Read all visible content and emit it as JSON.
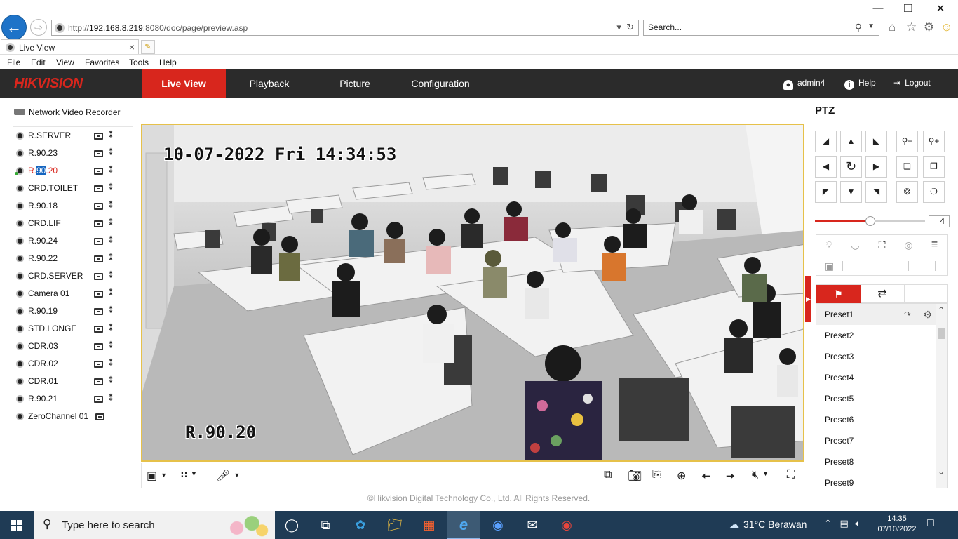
{
  "browser": {
    "url_prefix": "http://",
    "url_host": "192.168.8.219",
    "url_rest": ":8080/doc/page/preview.asp",
    "search_placeholder": "Search...",
    "tab_title": "Live View",
    "menu": [
      "File",
      "Edit",
      "View",
      "Favorites",
      "Tools",
      "Help"
    ]
  },
  "header": {
    "logo_main": "HIK",
    "logo_rest": "VISION",
    "nav": [
      "Live View",
      "Playback",
      "Picture",
      "Configuration"
    ],
    "active_nav": "Live View",
    "user": "admin4",
    "help": "Help",
    "logout": "Logout"
  },
  "sidebar": {
    "root": "Network Video Recorder",
    "cameras": [
      {
        "name": "R.SERVER"
      },
      {
        "name": "R.90.23"
      },
      {
        "name_pre": "R.",
        "name_hl": "90",
        "name_post": ".20",
        "active": true
      },
      {
        "name": "CRD.TOILET"
      },
      {
        "name": "R.90.18"
      },
      {
        "name": "CRD.LIF"
      },
      {
        "name": "R.90.24"
      },
      {
        "name": "R.90.22"
      },
      {
        "name": "CRD.SERVER"
      },
      {
        "name": "Camera 01"
      },
      {
        "name": "R.90.19"
      },
      {
        "name": "STD.LONGE"
      },
      {
        "name": "CDR.03"
      },
      {
        "name": "CDR.02"
      },
      {
        "name": "CDR.01"
      },
      {
        "name": "R.90.21"
      },
      {
        "name": "ZeroChannel 01",
        "zero": true
      }
    ]
  },
  "video": {
    "osd_time": "10-07-2022 Fri 14:34:53",
    "osd_name": "R.90.20",
    "border_color": "#e6c14a"
  },
  "footer": {
    "copyright": "©Hikvision Digital Technology Co., Ltd. All Rights Reserved."
  },
  "ptz": {
    "title": "PTZ",
    "speed": 4,
    "speed_max": 7,
    "presets": [
      "Preset1",
      "Preset2",
      "Preset3",
      "Preset4",
      "Preset5",
      "Preset6",
      "Preset7",
      "Preset8",
      "Preset9"
    ],
    "selected_preset": "Preset1"
  },
  "taskbar": {
    "search_placeholder": "Type here to search",
    "weather": "31°C Berawan",
    "time": "14:35",
    "date": "07/10/2022"
  },
  "colors": {
    "brand_red": "#d8261d",
    "header_bg": "#2b2b2b",
    "taskbar_bg": "#1f3b55"
  }
}
